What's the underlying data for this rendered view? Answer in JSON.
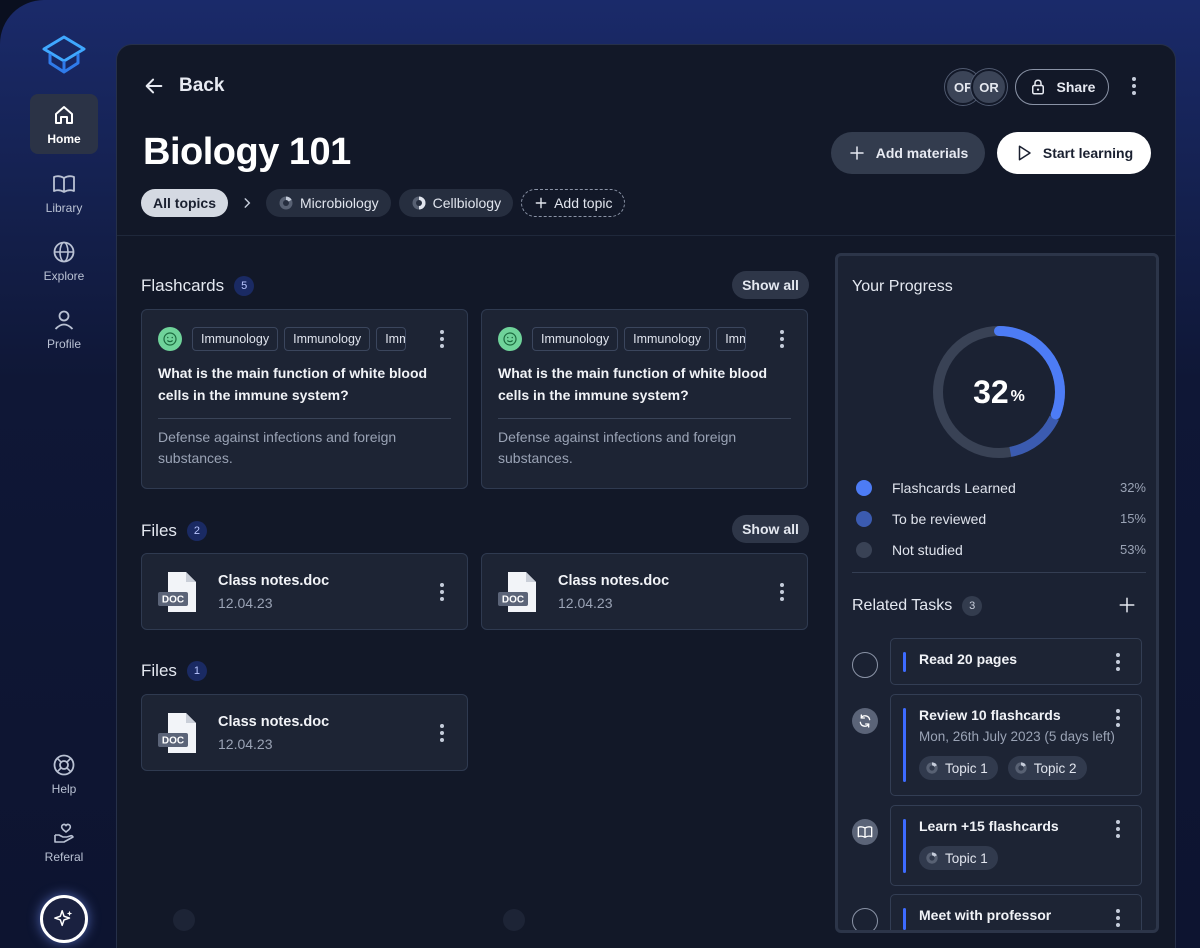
{
  "sidebar": {
    "items": [
      {
        "label": "Home"
      },
      {
        "label": "Library"
      },
      {
        "label": "Explore"
      },
      {
        "label": "Profile"
      },
      {
        "label": "Help"
      },
      {
        "label": "Referal"
      }
    ]
  },
  "header": {
    "back_label": "Back",
    "avatars": [
      "OF",
      "OR"
    ],
    "share_label": "Share",
    "title": "Biology 101",
    "add_materials_label": "Add materials",
    "start_learning_label": "Start learning"
  },
  "topics": {
    "all": "All topics",
    "items": [
      "Microbiology",
      "Cellbiology"
    ],
    "add_label": "Add topic"
  },
  "flashcards": {
    "title": "Flashcards",
    "count": "5",
    "show_all": "Show all",
    "cards": [
      {
        "tags": [
          "Immunology",
          "Immunology",
          "Imm"
        ],
        "question": "What is the main function of white blood cells in the immune system?",
        "answer": "Defense against infections and foreign substances."
      },
      {
        "tags": [
          "Immunology",
          "Immunology",
          "Imm"
        ],
        "question": "What is the main function of white blood cells in the immune system?",
        "answer": "Defense against infections and foreign substances."
      }
    ]
  },
  "files1": {
    "title": "Files",
    "count": "2",
    "show_all": "Show all",
    "items": [
      {
        "badge": "DOC",
        "name": "Class notes.doc",
        "date": "12.04.23"
      },
      {
        "badge": "DOC",
        "name": "Class notes.doc",
        "date": "12.04.23"
      }
    ]
  },
  "files2": {
    "title": "Files",
    "count": "1",
    "items": [
      {
        "badge": "DOC",
        "name": "Class notes.doc",
        "date": "12.04.23"
      }
    ]
  },
  "progress": {
    "title": "Your Progress",
    "percent": "32",
    "percent_unit": "%",
    "learned_fraction": 0.32,
    "reviewed_fraction": 0.15,
    "legend": [
      {
        "label": "Flashcards Learned",
        "value": "32%",
        "color": "#4d7cf5"
      },
      {
        "label": "To be reviewed",
        "value": "15%",
        "color": "#3b5bb0"
      },
      {
        "label": "Not studied",
        "value": "53%",
        "color": "#394255"
      }
    ]
  },
  "tasks": {
    "title": "Related Tasks",
    "count": "3",
    "items": [
      {
        "title": "Read 20 pages",
        "icon": "empty-circle-icon"
      },
      {
        "title": "Review 10 flashcards",
        "subtitle": "Mon, 26th July 2023 (5 days left)",
        "chips": [
          "Topic 1",
          "Topic 2"
        ],
        "icon": "refresh-icon"
      },
      {
        "title": "Learn +15 flashcards",
        "chips": [
          "Topic 1"
        ],
        "icon": "book-icon"
      },
      {
        "title": "Meet with professor",
        "icon": "empty-circle-icon"
      }
    ]
  },
  "colors": {
    "accent": "#3d6bff",
    "donut_learned": "#4d7cf5",
    "donut_reviewed": "#3b5bb0",
    "donut_track": "#394255"
  }
}
